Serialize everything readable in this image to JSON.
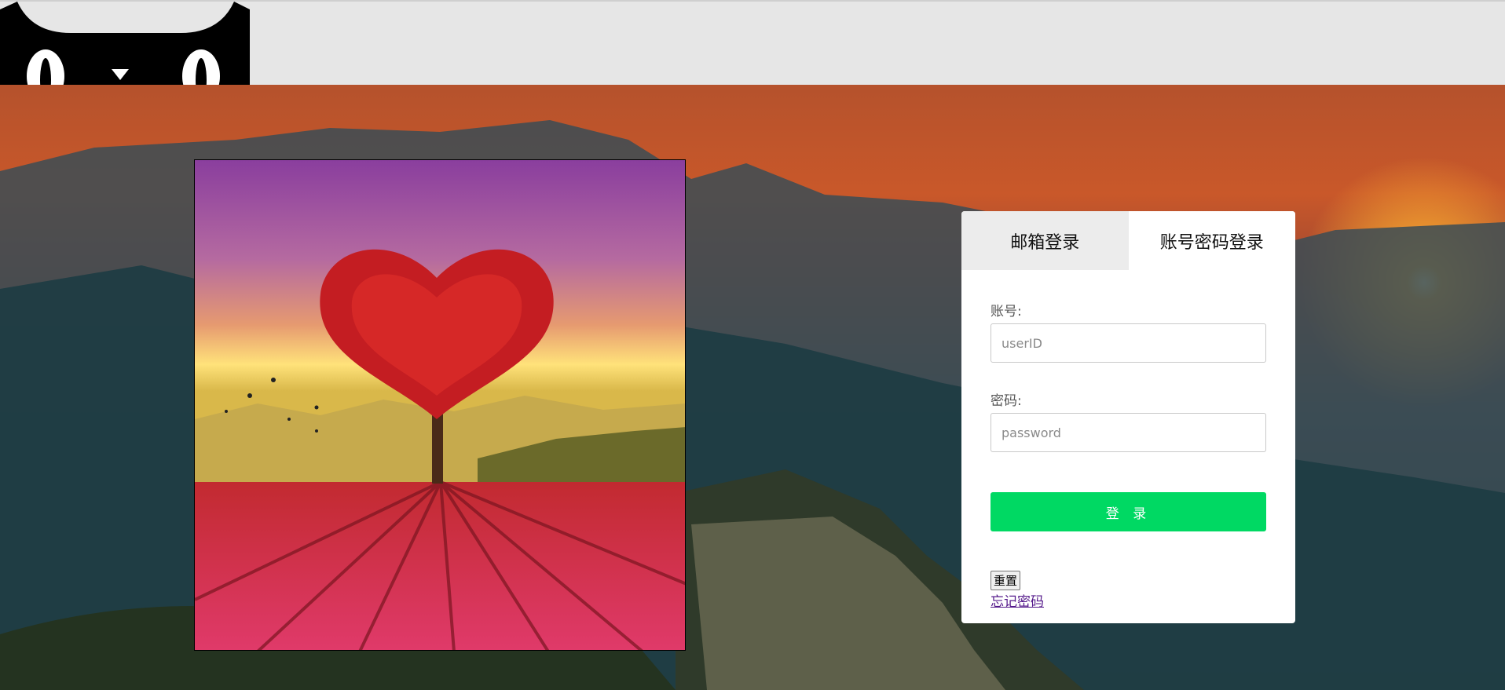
{
  "tabs": [
    {
      "label": "邮箱登录",
      "active": false
    },
    {
      "label": "账号密码登录",
      "active": true
    }
  ],
  "form": {
    "account_label": "账号:",
    "account_placeholder": "userID",
    "password_label": "密码:",
    "password_placeholder": "password",
    "submit_label": "登 录",
    "reset_label": "重置",
    "forgot_label": "忘记密码"
  },
  "colors": {
    "submit_bg": "#00d963",
    "topbar_bg": "#e6e6e6",
    "link": "#551a8b"
  },
  "icons": {
    "logo": "black-cat-logo-icon"
  }
}
